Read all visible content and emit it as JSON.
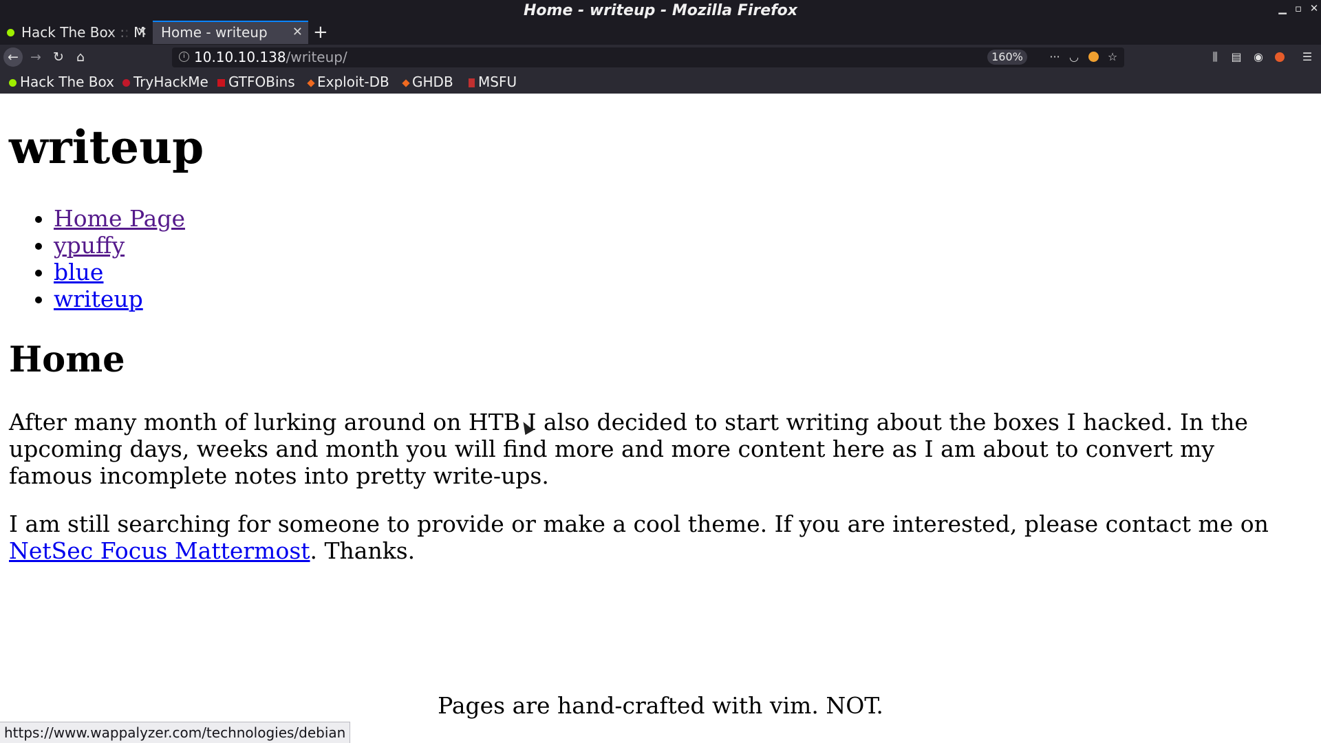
{
  "window": {
    "title": "Home - writeup - Mozilla Firefox"
  },
  "tabs": [
    {
      "label": "Hack The Box :: M",
      "favicon": "htb-cube-icon"
    },
    {
      "label": "Home - writeup",
      "active": true
    }
  ],
  "navbar": {
    "url_host": "10.10.10.138",
    "url_path": "/writeup/",
    "zoom": "160%"
  },
  "bookmarks": [
    {
      "label": "Hack The Box"
    },
    {
      "label": "TryHackMe"
    },
    {
      "label": "GTFOBins"
    },
    {
      "label": "Exploit-DB"
    },
    {
      "label": "GHDB"
    },
    {
      "label": "MSFU"
    }
  ],
  "page": {
    "site_title": "writeup",
    "nav": [
      {
        "label": "Home Page",
        "visited": true
      },
      {
        "label": "ypuffy",
        "visited": true
      },
      {
        "label": "blue",
        "visited": false
      },
      {
        "label": "writeup",
        "visited": false
      }
    ],
    "heading": "Home",
    "paragraph_1": "After many month of lurking around on HTB I also decided to start writing about the boxes I hacked. In the upcoming days, weeks and month you will find more and more content here as I am about to convert my famous incomplete notes into pretty write-ups.",
    "paragraph_2_before": "I am still searching for someone to provide or make a cool theme. If you are interested, please contact me on ",
    "paragraph_2_link": "NetSec Focus Mattermost",
    "paragraph_2_after": ". Thanks.",
    "footer": "Pages are hand-crafted with vim. NOT."
  },
  "statusbar": {
    "text": "https://www.wappalyzer.com/technologies/debian"
  },
  "colors": {
    "link": "#0000ee",
    "visited_link": "#551a8b",
    "chrome_dark": "#1c1b22",
    "toolbar": "#2b2a33",
    "tab_accent": "#0a84ff"
  }
}
